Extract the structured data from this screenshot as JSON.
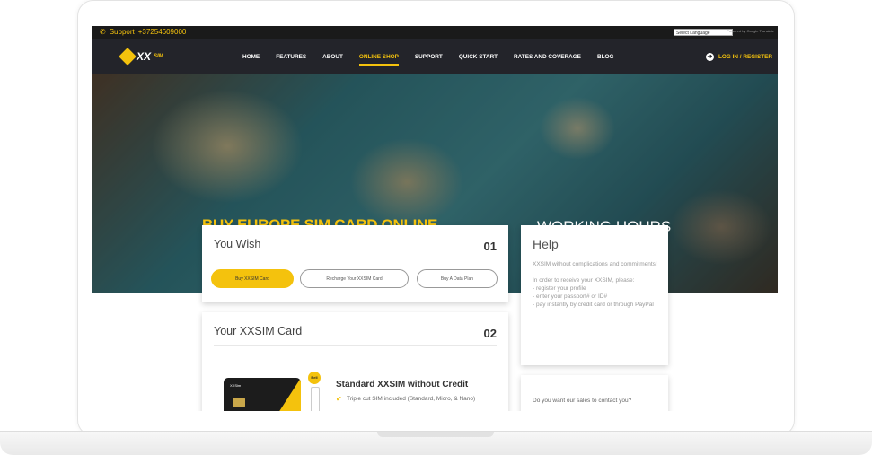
{
  "topbar": {
    "support_label": "Support",
    "phone": "+37254609000",
    "language": "Select Language",
    "powered_by": "Powered by Google Translate"
  },
  "nav": {
    "logo_text": "XX",
    "logo_sub": "SIM",
    "items": [
      "HOME",
      "FEATURES",
      "ABOUT",
      "ONLINE SHOP",
      "SUPPORT",
      "QUICK START",
      "RATES AND COVERAGE",
      "BLOG"
    ],
    "active": "ONLINE SHOP",
    "login": "LOG IN / REGISTER"
  },
  "hero": {
    "title": "BUY EUROPE SIM CARD ONLINE",
    "hours": "WORKING HOURS"
  },
  "wish_card": {
    "title": "You Wish",
    "number": "01",
    "buttons": [
      "Buy XXSIM Card",
      "Recharge Your XXSIM Card",
      "Buy A Data Plan"
    ]
  },
  "xxsim_card": {
    "title": "Your XXSIM Card",
    "number": "02",
    "card_label": "XXSim",
    "tag": "Bell",
    "product_name": "Standard XXSIM without Credit",
    "feature": "Triple cut SIM included (Standard, Micro, & Nano)"
  },
  "help_card": {
    "title": "Help",
    "p1": "XXSIM without complications and commitments!",
    "p2": "In order to receive your XXSIM, please:",
    "steps": [
      "- register your profile",
      "- enter your passport# or ID#",
      "- pay instantly by credit card or through PayPal"
    ]
  },
  "contact_card": {
    "text": "Do you want our sales to contact you?"
  },
  "colors": {
    "accent": "#f4c20d",
    "nav_bg": "#23242a"
  }
}
